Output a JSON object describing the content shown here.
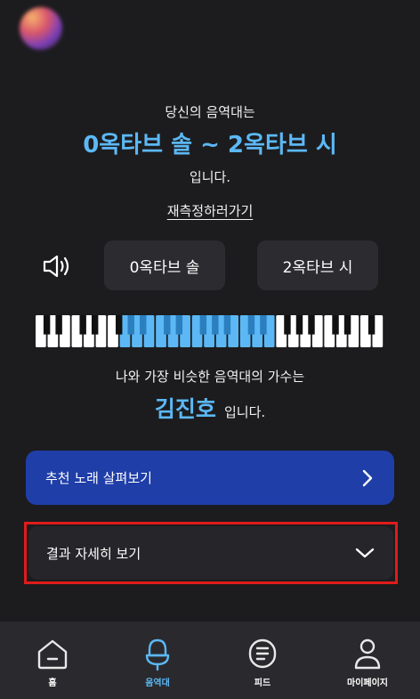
{
  "intro_text": "당신의 음역대는",
  "range_title": "0옥타브 솔 ~ 2옥타브 시",
  "range_suffix": "입니다.",
  "remeasure_link": "재측정하러가기",
  "notes": {
    "low_label": "0옥타브 솔",
    "high_label": "2옥타브 시"
  },
  "piano": {
    "white_key_count": 29,
    "highlight_first_white": 7,
    "highlight_last_white": 19,
    "highlight_color": "#5cb8f5"
  },
  "singer_intro": "나와 가장 비슷한 음역대의 가수는",
  "singer_name": "김진호",
  "singer_suffix": "입니다.",
  "recommend_button": "추천 노래 살펴보기",
  "details_button": "결과 자세히 보기",
  "tabs": [
    {
      "label": "홈",
      "icon": "home-icon",
      "active": false
    },
    {
      "label": "음역대",
      "icon": "microphone-icon",
      "active": true
    },
    {
      "label": "피드",
      "icon": "feed-icon",
      "active": false
    },
    {
      "label": "마이페이지",
      "icon": "profile-icon",
      "active": false
    }
  ],
  "colors": {
    "accent": "#5cb8f5",
    "primary_button": "#1f3ea8",
    "highlight_border": "#e01b1b"
  }
}
